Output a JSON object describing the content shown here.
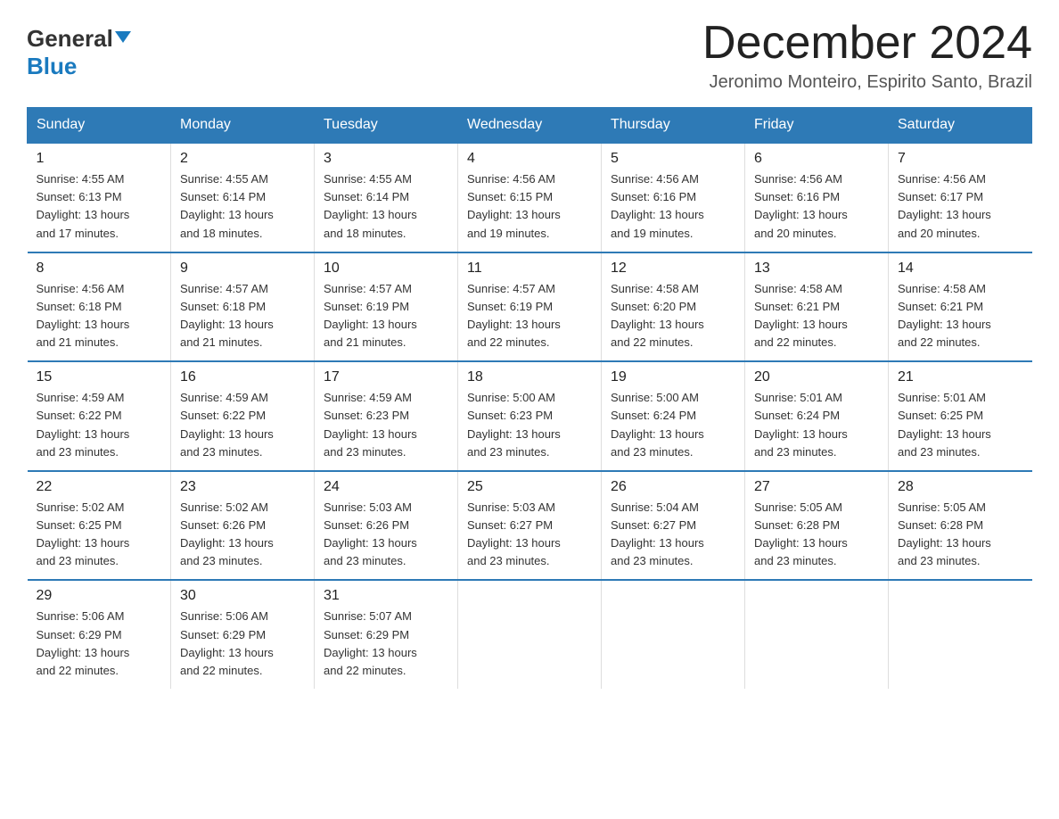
{
  "logo": {
    "general": "General",
    "arrow": "▶",
    "blue": "Blue"
  },
  "title": "December 2024",
  "subtitle": "Jeronimo Monteiro, Espirito Santo, Brazil",
  "days_of_week": [
    "Sunday",
    "Monday",
    "Tuesday",
    "Wednesday",
    "Thursday",
    "Friday",
    "Saturday"
  ],
  "weeks": [
    [
      {
        "day": "1",
        "sunrise": "4:55 AM",
        "sunset": "6:13 PM",
        "daylight": "13 hours and 17 minutes."
      },
      {
        "day": "2",
        "sunrise": "4:55 AM",
        "sunset": "6:14 PM",
        "daylight": "13 hours and 18 minutes."
      },
      {
        "day": "3",
        "sunrise": "4:55 AM",
        "sunset": "6:14 PM",
        "daylight": "13 hours and 18 minutes."
      },
      {
        "day": "4",
        "sunrise": "4:56 AM",
        "sunset": "6:15 PM",
        "daylight": "13 hours and 19 minutes."
      },
      {
        "day": "5",
        "sunrise": "4:56 AM",
        "sunset": "6:16 PM",
        "daylight": "13 hours and 19 minutes."
      },
      {
        "day": "6",
        "sunrise": "4:56 AM",
        "sunset": "6:16 PM",
        "daylight": "13 hours and 20 minutes."
      },
      {
        "day": "7",
        "sunrise": "4:56 AM",
        "sunset": "6:17 PM",
        "daylight": "13 hours and 20 minutes."
      }
    ],
    [
      {
        "day": "8",
        "sunrise": "4:56 AM",
        "sunset": "6:18 PM",
        "daylight": "13 hours and 21 minutes."
      },
      {
        "day": "9",
        "sunrise": "4:57 AM",
        "sunset": "6:18 PM",
        "daylight": "13 hours and 21 minutes."
      },
      {
        "day": "10",
        "sunrise": "4:57 AM",
        "sunset": "6:19 PM",
        "daylight": "13 hours and 21 minutes."
      },
      {
        "day": "11",
        "sunrise": "4:57 AM",
        "sunset": "6:19 PM",
        "daylight": "13 hours and 22 minutes."
      },
      {
        "day": "12",
        "sunrise": "4:58 AM",
        "sunset": "6:20 PM",
        "daylight": "13 hours and 22 minutes."
      },
      {
        "day": "13",
        "sunrise": "4:58 AM",
        "sunset": "6:21 PM",
        "daylight": "13 hours and 22 minutes."
      },
      {
        "day": "14",
        "sunrise": "4:58 AM",
        "sunset": "6:21 PM",
        "daylight": "13 hours and 22 minutes."
      }
    ],
    [
      {
        "day": "15",
        "sunrise": "4:59 AM",
        "sunset": "6:22 PM",
        "daylight": "13 hours and 23 minutes."
      },
      {
        "day": "16",
        "sunrise": "4:59 AM",
        "sunset": "6:22 PM",
        "daylight": "13 hours and 23 minutes."
      },
      {
        "day": "17",
        "sunrise": "4:59 AM",
        "sunset": "6:23 PM",
        "daylight": "13 hours and 23 minutes."
      },
      {
        "day": "18",
        "sunrise": "5:00 AM",
        "sunset": "6:23 PM",
        "daylight": "13 hours and 23 minutes."
      },
      {
        "day": "19",
        "sunrise": "5:00 AM",
        "sunset": "6:24 PM",
        "daylight": "13 hours and 23 minutes."
      },
      {
        "day": "20",
        "sunrise": "5:01 AM",
        "sunset": "6:24 PM",
        "daylight": "13 hours and 23 minutes."
      },
      {
        "day": "21",
        "sunrise": "5:01 AM",
        "sunset": "6:25 PM",
        "daylight": "13 hours and 23 minutes."
      }
    ],
    [
      {
        "day": "22",
        "sunrise": "5:02 AM",
        "sunset": "6:25 PM",
        "daylight": "13 hours and 23 minutes."
      },
      {
        "day": "23",
        "sunrise": "5:02 AM",
        "sunset": "6:26 PM",
        "daylight": "13 hours and 23 minutes."
      },
      {
        "day": "24",
        "sunrise": "5:03 AM",
        "sunset": "6:26 PM",
        "daylight": "13 hours and 23 minutes."
      },
      {
        "day": "25",
        "sunrise": "5:03 AM",
        "sunset": "6:27 PM",
        "daylight": "13 hours and 23 minutes."
      },
      {
        "day": "26",
        "sunrise": "5:04 AM",
        "sunset": "6:27 PM",
        "daylight": "13 hours and 23 minutes."
      },
      {
        "day": "27",
        "sunrise": "5:05 AM",
        "sunset": "6:28 PM",
        "daylight": "13 hours and 23 minutes."
      },
      {
        "day": "28",
        "sunrise": "5:05 AM",
        "sunset": "6:28 PM",
        "daylight": "13 hours and 23 minutes."
      }
    ],
    [
      {
        "day": "29",
        "sunrise": "5:06 AM",
        "sunset": "6:29 PM",
        "daylight": "13 hours and 22 minutes."
      },
      {
        "day": "30",
        "sunrise": "5:06 AM",
        "sunset": "6:29 PM",
        "daylight": "13 hours and 22 minutes."
      },
      {
        "day": "31",
        "sunrise": "5:07 AM",
        "sunset": "6:29 PM",
        "daylight": "13 hours and 22 minutes."
      },
      null,
      null,
      null,
      null
    ]
  ],
  "labels": {
    "sunrise": "Sunrise: ",
    "sunset": "Sunset: ",
    "daylight": "Daylight: "
  }
}
